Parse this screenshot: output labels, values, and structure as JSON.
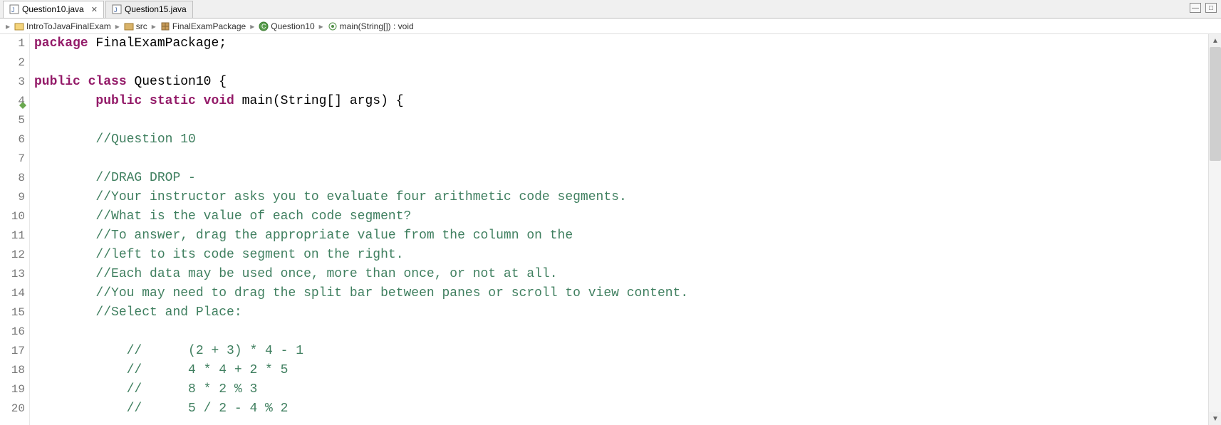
{
  "tabs": [
    {
      "label": "Question10.java",
      "active": true
    },
    {
      "label": "Question15.java",
      "active": false
    }
  ],
  "breadcrumb": {
    "items": [
      {
        "label": "IntroToJavaFinalExam",
        "icon": "project"
      },
      {
        "label": "src",
        "icon": "folder"
      },
      {
        "label": "FinalExamPackage",
        "icon": "package"
      },
      {
        "label": "Question10",
        "icon": "class"
      },
      {
        "label": "main(String[]) : void",
        "icon": "method"
      }
    ]
  },
  "code": {
    "lines": [
      {
        "n": 1,
        "segments": [
          {
            "t": "package ",
            "c": "kw"
          },
          {
            "t": "FinalExamPackage;",
            "c": "tp"
          }
        ]
      },
      {
        "n": 2,
        "segments": [
          {
            "t": "",
            "c": "tp"
          }
        ]
      },
      {
        "n": 3,
        "segments": [
          {
            "t": "public class ",
            "c": "kw"
          },
          {
            "t": "Question10 {",
            "c": "tp"
          }
        ]
      },
      {
        "n": 4,
        "override": true,
        "segments": [
          {
            "t": "        ",
            "c": "tp"
          },
          {
            "t": "public static void ",
            "c": "kw"
          },
          {
            "t": "main(String[] args) {",
            "c": "tp"
          }
        ]
      },
      {
        "n": 5,
        "segments": [
          {
            "t": "",
            "c": "tp"
          }
        ]
      },
      {
        "n": 6,
        "segments": [
          {
            "t": "        ",
            "c": "tp"
          },
          {
            "t": "//Question 10",
            "c": "cm"
          }
        ]
      },
      {
        "n": 7,
        "segments": [
          {
            "t": "",
            "c": "tp"
          }
        ]
      },
      {
        "n": 8,
        "segments": [
          {
            "t": "        ",
            "c": "tp"
          },
          {
            "t": "//DRAG DROP -",
            "c": "cm"
          }
        ]
      },
      {
        "n": 9,
        "segments": [
          {
            "t": "        ",
            "c": "tp"
          },
          {
            "t": "//Your instructor asks you to evaluate four arithmetic code segments.",
            "c": "cm"
          }
        ]
      },
      {
        "n": 10,
        "segments": [
          {
            "t": "        ",
            "c": "tp"
          },
          {
            "t": "//What is the value of each code segment?",
            "c": "cm"
          }
        ]
      },
      {
        "n": 11,
        "segments": [
          {
            "t": "        ",
            "c": "tp"
          },
          {
            "t": "//To answer, drag the appropriate value from the column on the",
            "c": "cm"
          }
        ]
      },
      {
        "n": 12,
        "segments": [
          {
            "t": "        ",
            "c": "tp"
          },
          {
            "t": "//left to its code segment on the right.",
            "c": "cm"
          }
        ]
      },
      {
        "n": 13,
        "segments": [
          {
            "t": "        ",
            "c": "tp"
          },
          {
            "t": "//Each data may be used once, more than once, or not at all.",
            "c": "cm"
          }
        ]
      },
      {
        "n": 14,
        "segments": [
          {
            "t": "        ",
            "c": "tp"
          },
          {
            "t": "//You may need to drag the split bar between panes or scroll to view content.",
            "c": "cm"
          }
        ]
      },
      {
        "n": 15,
        "segments": [
          {
            "t": "        ",
            "c": "tp"
          },
          {
            "t": "//Select and Place:",
            "c": "cm"
          }
        ]
      },
      {
        "n": 16,
        "segments": [
          {
            "t": "",
            "c": "tp"
          }
        ]
      },
      {
        "n": 17,
        "segments": [
          {
            "t": "            ",
            "c": "tp"
          },
          {
            "t": "//      (2 + 3) * 4 - 1",
            "c": "cm"
          }
        ]
      },
      {
        "n": 18,
        "segments": [
          {
            "t": "            ",
            "c": "tp"
          },
          {
            "t": "//      4 * 4 + 2 * 5",
            "c": "cm"
          }
        ]
      },
      {
        "n": 19,
        "segments": [
          {
            "t": "            ",
            "c": "tp"
          },
          {
            "t": "//      8 * 2 % 3",
            "c": "cm"
          }
        ]
      },
      {
        "n": 20,
        "segments": [
          {
            "t": "            ",
            "c": "tp"
          },
          {
            "t": "//      5 / 2 - 4 % 2",
            "c": "cm"
          }
        ]
      }
    ]
  },
  "window_controls": {
    "minimize": "—",
    "maximize": "□"
  }
}
